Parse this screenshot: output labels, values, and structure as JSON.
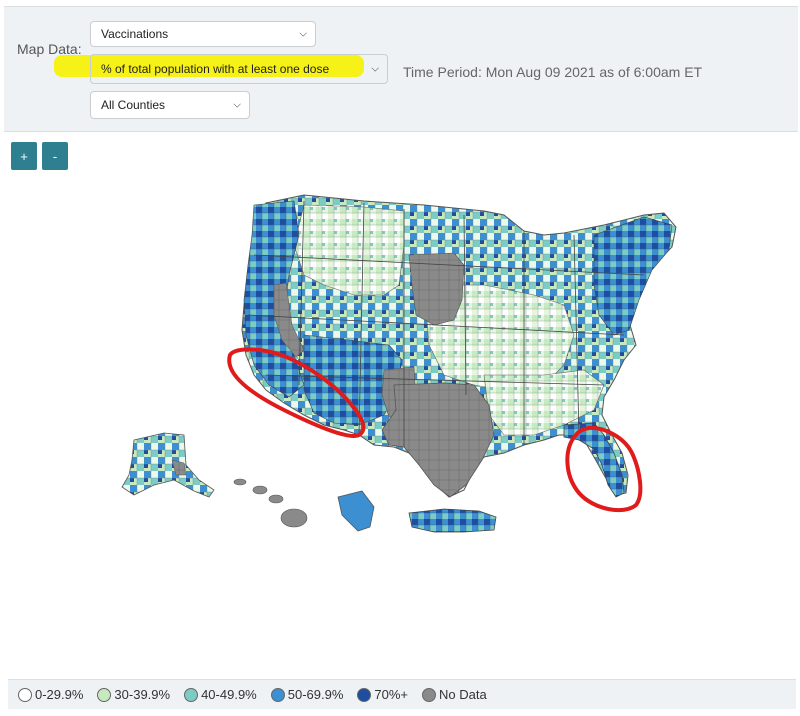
{
  "controls": {
    "map_data_label": "Map Data:",
    "metric_select": "Vaccinations",
    "measure_select": "% of total population with at least one dose",
    "area_select": "All Counties",
    "time_period": "Time Period: Mon Aug 09 2021 as of 6:00am ET"
  },
  "zoom": {
    "in_label": "+",
    "out_label": "-"
  },
  "legend": [
    {
      "label": "0-29.9%",
      "color": "#ffffff"
    },
    {
      "label": "30-39.9%",
      "color": "#c7e9c0"
    },
    {
      "label": "40-49.9%",
      "color": "#7ccbc4"
    },
    {
      "label": "50-69.9%",
      "color": "#3c8fd1"
    },
    {
      "label": "70%+",
      "color": "#1f4da0"
    },
    {
      "label": "No Data",
      "color": "#8a8a8a"
    }
  ],
  "colors": {
    "annotation": "#e01b1b",
    "highlight": "#f6f200",
    "button": "#2e7f8f"
  }
}
